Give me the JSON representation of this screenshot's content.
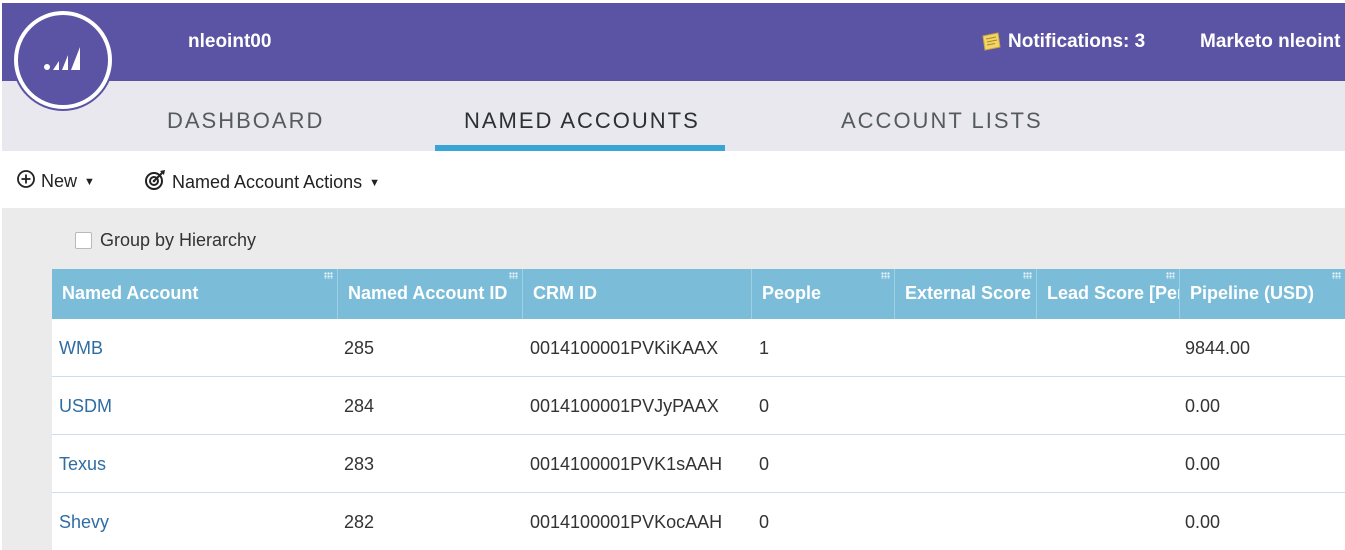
{
  "header": {
    "account_name": "nleoint00",
    "notifications": "Notifications: 3",
    "user_name": "Marketo nleoint"
  },
  "tabs": [
    "DASHBOARD",
    "NAMED ACCOUNTS",
    "ACCOUNT LISTS"
  ],
  "active_tab": "NAMED ACCOUNTS",
  "toolbar": {
    "new_label": "New",
    "actions_label": "Named Account Actions"
  },
  "options": {
    "group_by_hierarchy_label": "Group by Hierarchy",
    "group_by_hierarchy_checked": false
  },
  "table": {
    "columns": [
      "Named Account",
      "Named Account ID",
      "CRM ID",
      "People",
      "External Score [",
      "Lead Score [Per",
      "Pipeline (USD)"
    ],
    "rows": [
      {
        "name": "WMB",
        "id": "285",
        "crm_id": "0014100001PVKiKAAX",
        "people": "1",
        "external_score": "",
        "lead_score": "",
        "pipeline": "9844.00"
      },
      {
        "name": "USDM",
        "id": "284",
        "crm_id": "0014100001PVJyPAAX",
        "people": "0",
        "external_score": "",
        "lead_score": "",
        "pipeline": "0.00"
      },
      {
        "name": "Texus",
        "id": "283",
        "crm_id": "0014100001PVK1sAAH",
        "people": "0",
        "external_score": "",
        "lead_score": "",
        "pipeline": "0.00"
      },
      {
        "name": "Shevy",
        "id": "282",
        "crm_id": "0014100001PVKocAAH",
        "people": "0",
        "external_score": "",
        "lead_score": "",
        "pipeline": "0.00"
      }
    ]
  },
  "colors": {
    "header_purple": "#5b53a3",
    "tab_underline": "#3aa4d6",
    "table_header": "#7bbcd8",
    "link": "#2f6da3"
  },
  "icons": {
    "logo": "marketo-logo-icon",
    "notifications": "notification-note-icon",
    "new": "plus-circle-icon",
    "actions": "target-gear-icon",
    "column_grip": "column-grip-icon"
  }
}
